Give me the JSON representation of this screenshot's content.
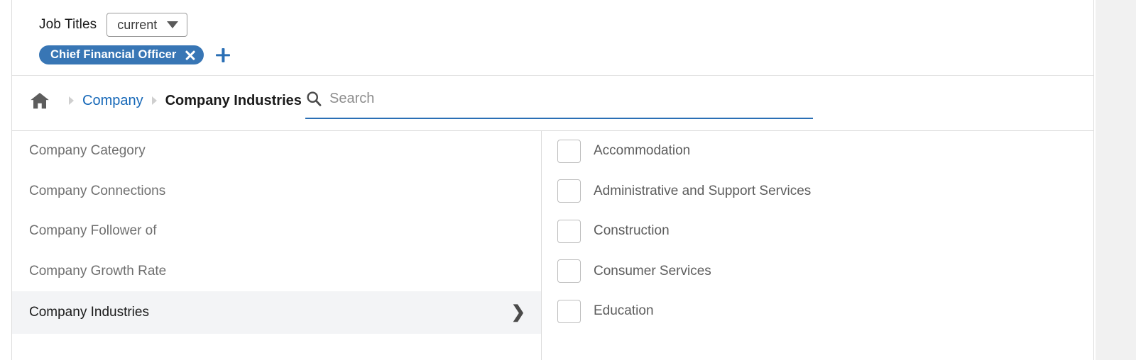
{
  "filters": {
    "label": "Job Titles",
    "scope": {
      "value": "current",
      "caret_icon": "chevron-down-icon"
    },
    "tags": [
      {
        "label": "Chief Financial Officer",
        "remove_icon": "close-icon"
      }
    ],
    "add_icon": "plus-icon",
    "add_label": "+"
  },
  "breadcrumb": {
    "home_icon": "home-icon",
    "separator_icon": "chevron-right-icon",
    "items": [
      {
        "label": "Company",
        "current": false
      },
      {
        "label": "Company Industries",
        "current": true
      }
    ]
  },
  "search": {
    "icon": "search-icon",
    "value": "",
    "placeholder": "Search"
  },
  "facets": {
    "items": [
      {
        "label": "Company Category",
        "active": false
      },
      {
        "label": "Company Connections",
        "active": false
      },
      {
        "label": "Company Follower of",
        "active": false
      },
      {
        "label": "Company Growth Rate",
        "active": false
      },
      {
        "label": "Company Industries",
        "active": true,
        "chevron": "❯"
      }
    ]
  },
  "options": {
    "items": [
      {
        "label": "Accommodation",
        "checked": false
      },
      {
        "label": "Administrative and Support Services",
        "checked": false
      },
      {
        "label": "Construction",
        "checked": false
      },
      {
        "label": "Consumer Services",
        "checked": false
      },
      {
        "label": "Education",
        "checked": false
      }
    ]
  },
  "colors": {
    "tag_blue": "#3876b5",
    "link_blue": "#1668b8",
    "accent_blue": "#2a6fb5",
    "active_row_bg": "#f3f4f6",
    "page_bg": "#f1f1f1"
  }
}
